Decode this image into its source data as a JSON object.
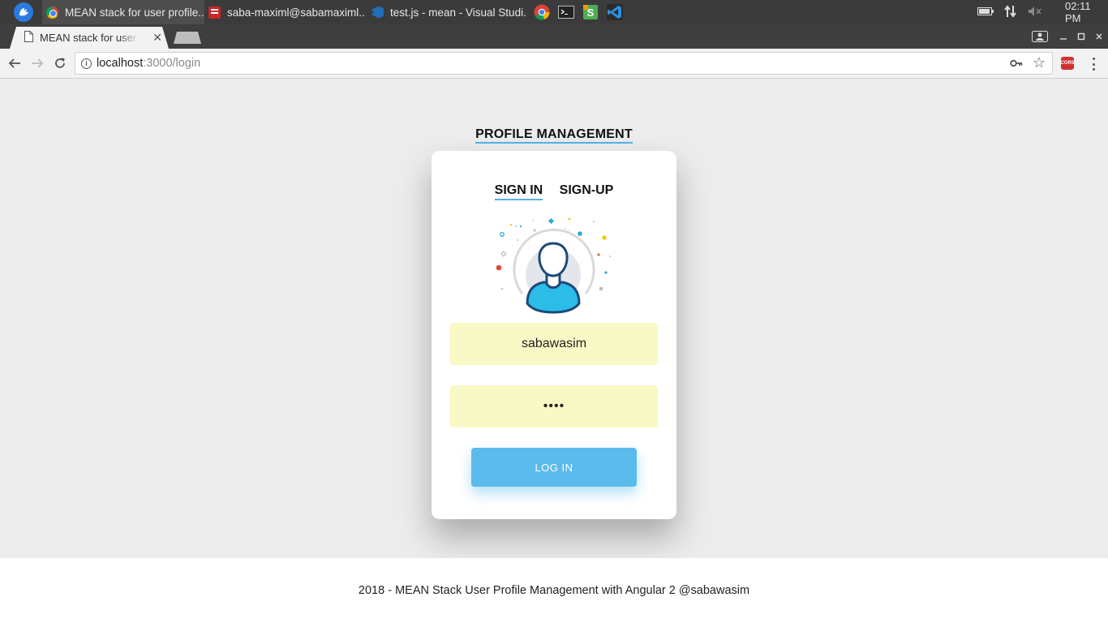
{
  "taskbar": {
    "tasks": [
      {
        "label": "MEAN stack for user profile...",
        "icon": "chrome-icon"
      },
      {
        "label": "saba-maximl@sabamaximl...",
        "icon": "terminal-icon"
      },
      {
        "label": "test.js - mean - Visual Studi...",
        "icon": "vscode-icon"
      }
    ],
    "pinned": [
      "chrome-icon",
      "terminal-icon",
      "sublime-icon",
      "vscode-icon"
    ],
    "clock": "02:11 PM"
  },
  "browser": {
    "tab_title": "MEAN stack for user profile",
    "close_glyph": "✕",
    "url_host": "localhost",
    "url_path": ":3000/login",
    "extension_badge": "CORS"
  },
  "page": {
    "heading": "PROFILE MANAGEMENT",
    "tabs": {
      "sign_in": "SIGN IN",
      "sign_up": "SIGN-UP"
    },
    "username_value": "sabawasim",
    "password_value": "••••",
    "login_label": "LOG IN",
    "footer": "2018 - MEAN Stack User Profile Management with Angular 2 @sabawasim"
  },
  "colors": {
    "accent": "#54b3ea",
    "button": "#5bbbec",
    "input_bg": "#f8f9c4",
    "page_bg": "#ececec"
  }
}
